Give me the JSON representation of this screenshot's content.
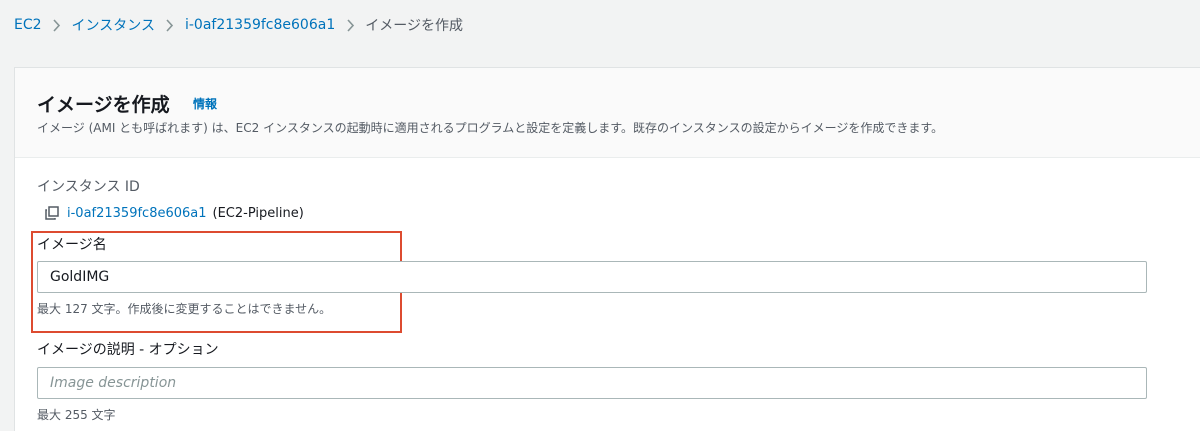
{
  "breadcrumb": {
    "items": [
      {
        "label": "EC2"
      },
      {
        "label": "インスタンス"
      },
      {
        "label": "i-0af21359fc8e606a1"
      }
    ],
    "current": "イメージを作成"
  },
  "panel": {
    "title": "イメージを作成",
    "info_label": "情報",
    "description": "イメージ (AMI とも呼ばれます) は、EC2 インスタンスの起動時に適用されるプログラムと設定を定義します。既存のインスタンスの設定からイメージを作成できます。"
  },
  "instance": {
    "label": "インスタンス ID",
    "id": "i-0af21359fc8e606a1",
    "name": "(EC2-Pipeline)"
  },
  "image_name": {
    "label": "イメージ名",
    "value": "GoldIMG",
    "hint": "最大 127 文字。作成後に変更することはできません。"
  },
  "image_description": {
    "label": "イメージの説明 - オプション",
    "placeholder": "Image description",
    "hint": "最大 255 文字"
  },
  "colors": {
    "link": "#0073bb",
    "highlight": "#dd4b30",
    "background": "#f2f3f3"
  },
  "icons": {
    "breadcrumb_separator": "chevron-right-icon",
    "copy": "copy-icon"
  }
}
